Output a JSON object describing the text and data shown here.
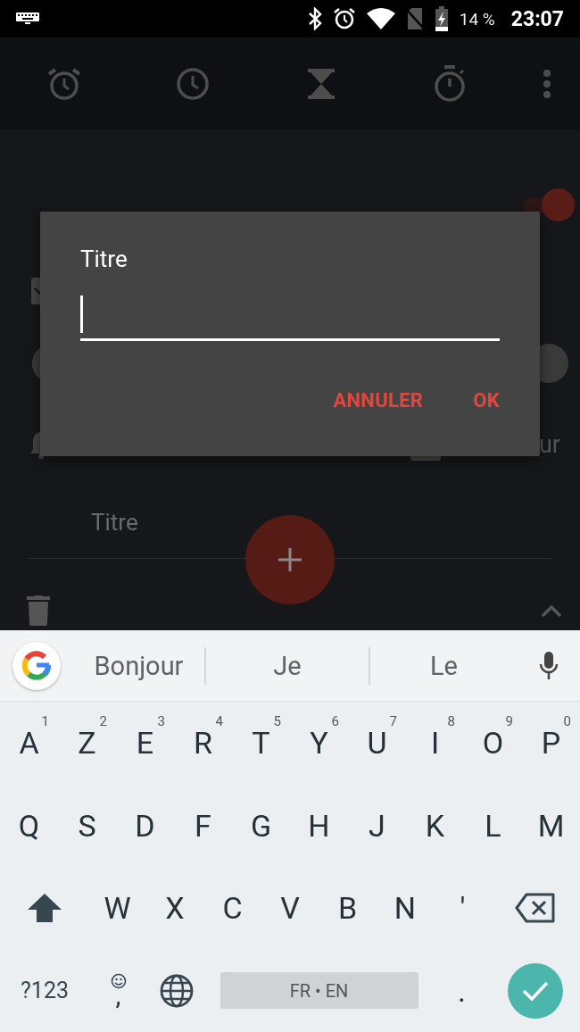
{
  "status_bar": {
    "battery": "14 %",
    "time": "23:07"
  },
  "tabs": [
    {
      "kind": "alarm"
    },
    {
      "kind": "clock"
    },
    {
      "kind": "timer"
    },
    {
      "kind": "stopwatch"
    }
  ],
  "alarm": {
    "on": true,
    "checked": true,
    "label_fragment": "ur",
    "title": "Titre"
  },
  "dialog": {
    "title": "Titre",
    "buttons": [
      "ANNULER",
      "OK"
    ]
  },
  "keyboard": {
    "suggestions": [
      "Bonjour",
      "Je",
      "Le"
    ],
    "rows": [
      {
        "keys": [
          {
            "kind": "char",
            "label": "A",
            "hint": "1"
          },
          {
            "kind": "char",
            "label": "Z",
            "hint": "2"
          },
          {
            "kind": "char",
            "label": "E",
            "hint": "3"
          },
          {
            "kind": "char",
            "label": "R",
            "hint": "4"
          },
          {
            "kind": "char",
            "label": "T",
            "hint": "5"
          },
          {
            "kind": "char",
            "label": "Y",
            "hint": "6"
          },
          {
            "kind": "char",
            "label": "U",
            "hint": "7"
          },
          {
            "kind": "char",
            "label": "I",
            "hint": "8"
          },
          {
            "kind": "char",
            "label": "O",
            "hint": "9"
          },
          {
            "kind": "char",
            "label": "P",
            "hint": "0"
          }
        ]
      },
      {
        "keys": [
          {
            "kind": "char",
            "label": "Q"
          },
          {
            "kind": "char",
            "label": "S"
          },
          {
            "kind": "char",
            "label": "D"
          },
          {
            "kind": "char",
            "label": "F"
          },
          {
            "kind": "char",
            "label": "G"
          },
          {
            "kind": "char",
            "label": "H"
          },
          {
            "kind": "char",
            "label": "J"
          },
          {
            "kind": "char",
            "label": "K"
          },
          {
            "kind": "char",
            "label": "L"
          },
          {
            "kind": "char",
            "label": "M"
          }
        ]
      },
      {
        "keys": [
          {
            "kind": "shift"
          },
          {
            "kind": "char",
            "label": "W"
          },
          {
            "kind": "char",
            "label": "X"
          },
          {
            "kind": "char",
            "label": "C"
          },
          {
            "kind": "char",
            "label": "V"
          },
          {
            "kind": "char",
            "label": "B"
          },
          {
            "kind": "char",
            "label": "N"
          },
          {
            "kind": "char",
            "label": "'"
          },
          {
            "kind": "backspace"
          }
        ]
      },
      {
        "keys": [
          {
            "kind": "symbols",
            "label": "?123"
          },
          {
            "kind": "emoji-comma",
            "label": ","
          },
          {
            "kind": "globe"
          },
          {
            "kind": "space",
            "label": "FR • EN"
          },
          {
            "kind": "char",
            "label": "."
          },
          {
            "kind": "enter"
          }
        ]
      }
    ]
  }
}
